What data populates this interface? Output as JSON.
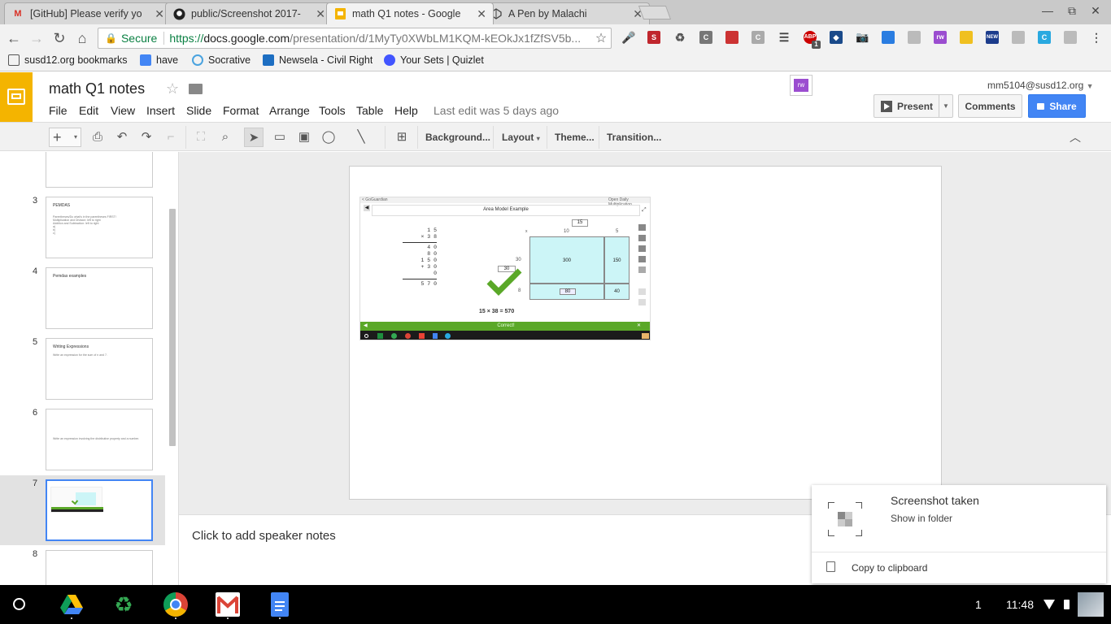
{
  "tabs": [
    {
      "title": "[GitHub] Please verify yo",
      "icon": "gmail-icon"
    },
    {
      "title": "public/Screenshot 2017-",
      "icon": "github-icon"
    },
    {
      "title": "math Q1 notes - Google",
      "icon": "slides-icon",
      "active": true
    },
    {
      "title": "A Pen by Malachi",
      "icon": "codepen-icon"
    }
  ],
  "omnibox": {
    "secure_label": "Secure",
    "url_scheme": "https://",
    "url_host": "docs.google.com",
    "url_path": "/presentation/d/1MyTy0XWbLM1KQM-kEOkJx1fZfSV5b..."
  },
  "extensions": {
    "abp_badge": "1"
  },
  "bookmarks": [
    {
      "label": "susd12.org bookmarks"
    },
    {
      "label": "have"
    },
    {
      "label": "Socrative"
    },
    {
      "label": "Newsela - Civil Rights"
    },
    {
      "label": "Your Sets | Quizlet"
    }
  ],
  "doc": {
    "title": "math Q1 notes",
    "menus": [
      "File",
      "Edit",
      "View",
      "Insert",
      "Slide",
      "Format",
      "Arrange",
      "Tools",
      "Table",
      "Help"
    ],
    "last_edit": "Last edit was 5 days ago",
    "account": "mm5104@susd12.org",
    "present_label": "Present",
    "comments_label": "Comments",
    "share_label": "Share"
  },
  "toolbar": {
    "background_label": "Background...",
    "layout_label": "Layout",
    "theme_label": "Theme...",
    "transition_label": "Transition..."
  },
  "slides": [
    {
      "num": "3",
      "title": "PEMDAS",
      "lines": [
        "Parentheses/Do what's in the parentheses FIRST!",
        "Multiplication and Division: left to right",
        "Addition and Subtraction: left to right",
        "a)",
        "b)",
        "c)"
      ]
    },
    {
      "num": "4",
      "title": "Pemdas examples",
      "lines": []
    },
    {
      "num": "5",
      "title": "Writing Expressions",
      "lines": [
        "Write an expression for the sum of n and 7."
      ]
    },
    {
      "num": "6",
      "title": "",
      "lines": [
        "Write an expression involving the distributive property and a number."
      ]
    },
    {
      "num": "7",
      "title": "",
      "lines": []
    },
    {
      "num": "8",
      "title": "",
      "lines": []
    }
  ],
  "slide_content": {
    "header_left": "< GoGuardian",
    "header_right": "Open Daily Multiplication",
    "app_title": "Area Model Example",
    "multiplication_lines": [
      "1 5",
      "× 3 8",
      "4 0",
      "8 0",
      "1 5 0",
      "+ 3 0 0",
      "5 7 0"
    ],
    "top_box_value": "15",
    "x_label": "x",
    "top_labels": [
      "10",
      "5"
    ],
    "left_labels": [
      "30",
      "8"
    ],
    "left_input": "30",
    "cells": [
      "300",
      "150",
      "80",
      "40"
    ],
    "equation": "15 × 38 = 570",
    "correct_banner": "Correct!"
  },
  "notes_placeholder": "Click to add speaker notes",
  "notification": {
    "title": "Screenshot taken",
    "link": "Show in folder",
    "action": "Copy to clipboard"
  },
  "shelf": {
    "page_count": "1",
    "time": "11:48"
  },
  "colors": {
    "slides_yellow": "#f4b400",
    "share_blue": "#4285f4",
    "area_cyan": "#ccf5f7",
    "correct_green": "#5aa828"
  }
}
